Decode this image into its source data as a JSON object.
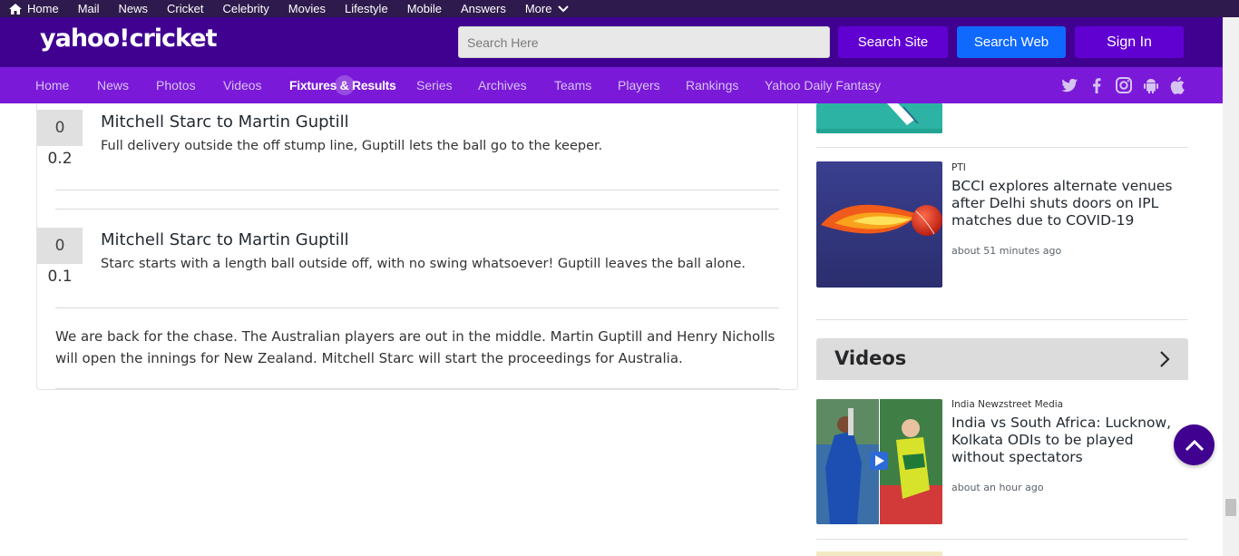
{
  "top_bar": {
    "items": [
      "Home",
      "Mail",
      "News",
      "Cricket",
      "Celebrity",
      "Movies",
      "Lifestyle",
      "Mobile",
      "Answers",
      "More"
    ]
  },
  "header": {
    "logo": "yahoo!cricket",
    "search_placeholder": "Search Here",
    "search_site": "Search Site",
    "search_web": "Search Web",
    "sign_in": "Sign In"
  },
  "subnav": {
    "items": [
      "Home",
      "News",
      "Photos",
      "Videos",
      "Fixtures & Results",
      "Series",
      "Archives",
      "Teams",
      "Players",
      "Rankings",
      "Yahoo Daily Fantasy"
    ],
    "active": "Fixtures & Results",
    "social_icons": [
      "twitter-icon",
      "facebook-icon",
      "instagram-icon",
      "android-icon",
      "apple-icon"
    ]
  },
  "commentary": {
    "balls": [
      {
        "runs": "0",
        "over": "0.2",
        "title": "Mitchell Starc to Martin Guptill",
        "text": "Full delivery outside the off stump line, Guptill lets the ball go to the keeper."
      },
      {
        "runs": "0",
        "over": "0.1",
        "title": "Mitchell Starc to Martin Guptill",
        "text": "Starc starts with a length ball outside off, with no swing whatsoever! Guptill leaves the ball alone."
      }
    ],
    "note": "We are back for the chase. The Australian players are out in the middle. Martin Guptill and Henry Nicholls will open the innings for New Zealand. Mitchell Starc will start the proceedings for Australia."
  },
  "rail": {
    "news": [
      {
        "source": "PTI",
        "headline": "BCCI explores alternate venues after Delhi shuts doors on IPL matches due to COVID-19",
        "time": "about 51 minutes ago"
      }
    ],
    "videos_title": "Videos",
    "videos": [
      {
        "source": "India Newzstreet Media",
        "headline": "India vs South Africa: Lucknow, Kolkata ODIs to be played without spectators",
        "time": "about an hour ago"
      }
    ]
  },
  "colors": {
    "top_bar": "#2e1a4d",
    "header": "#400090",
    "subnav": "#7b19d9",
    "search_site_btn": "#6001d2",
    "search_web_btn": "#0f69ff"
  }
}
